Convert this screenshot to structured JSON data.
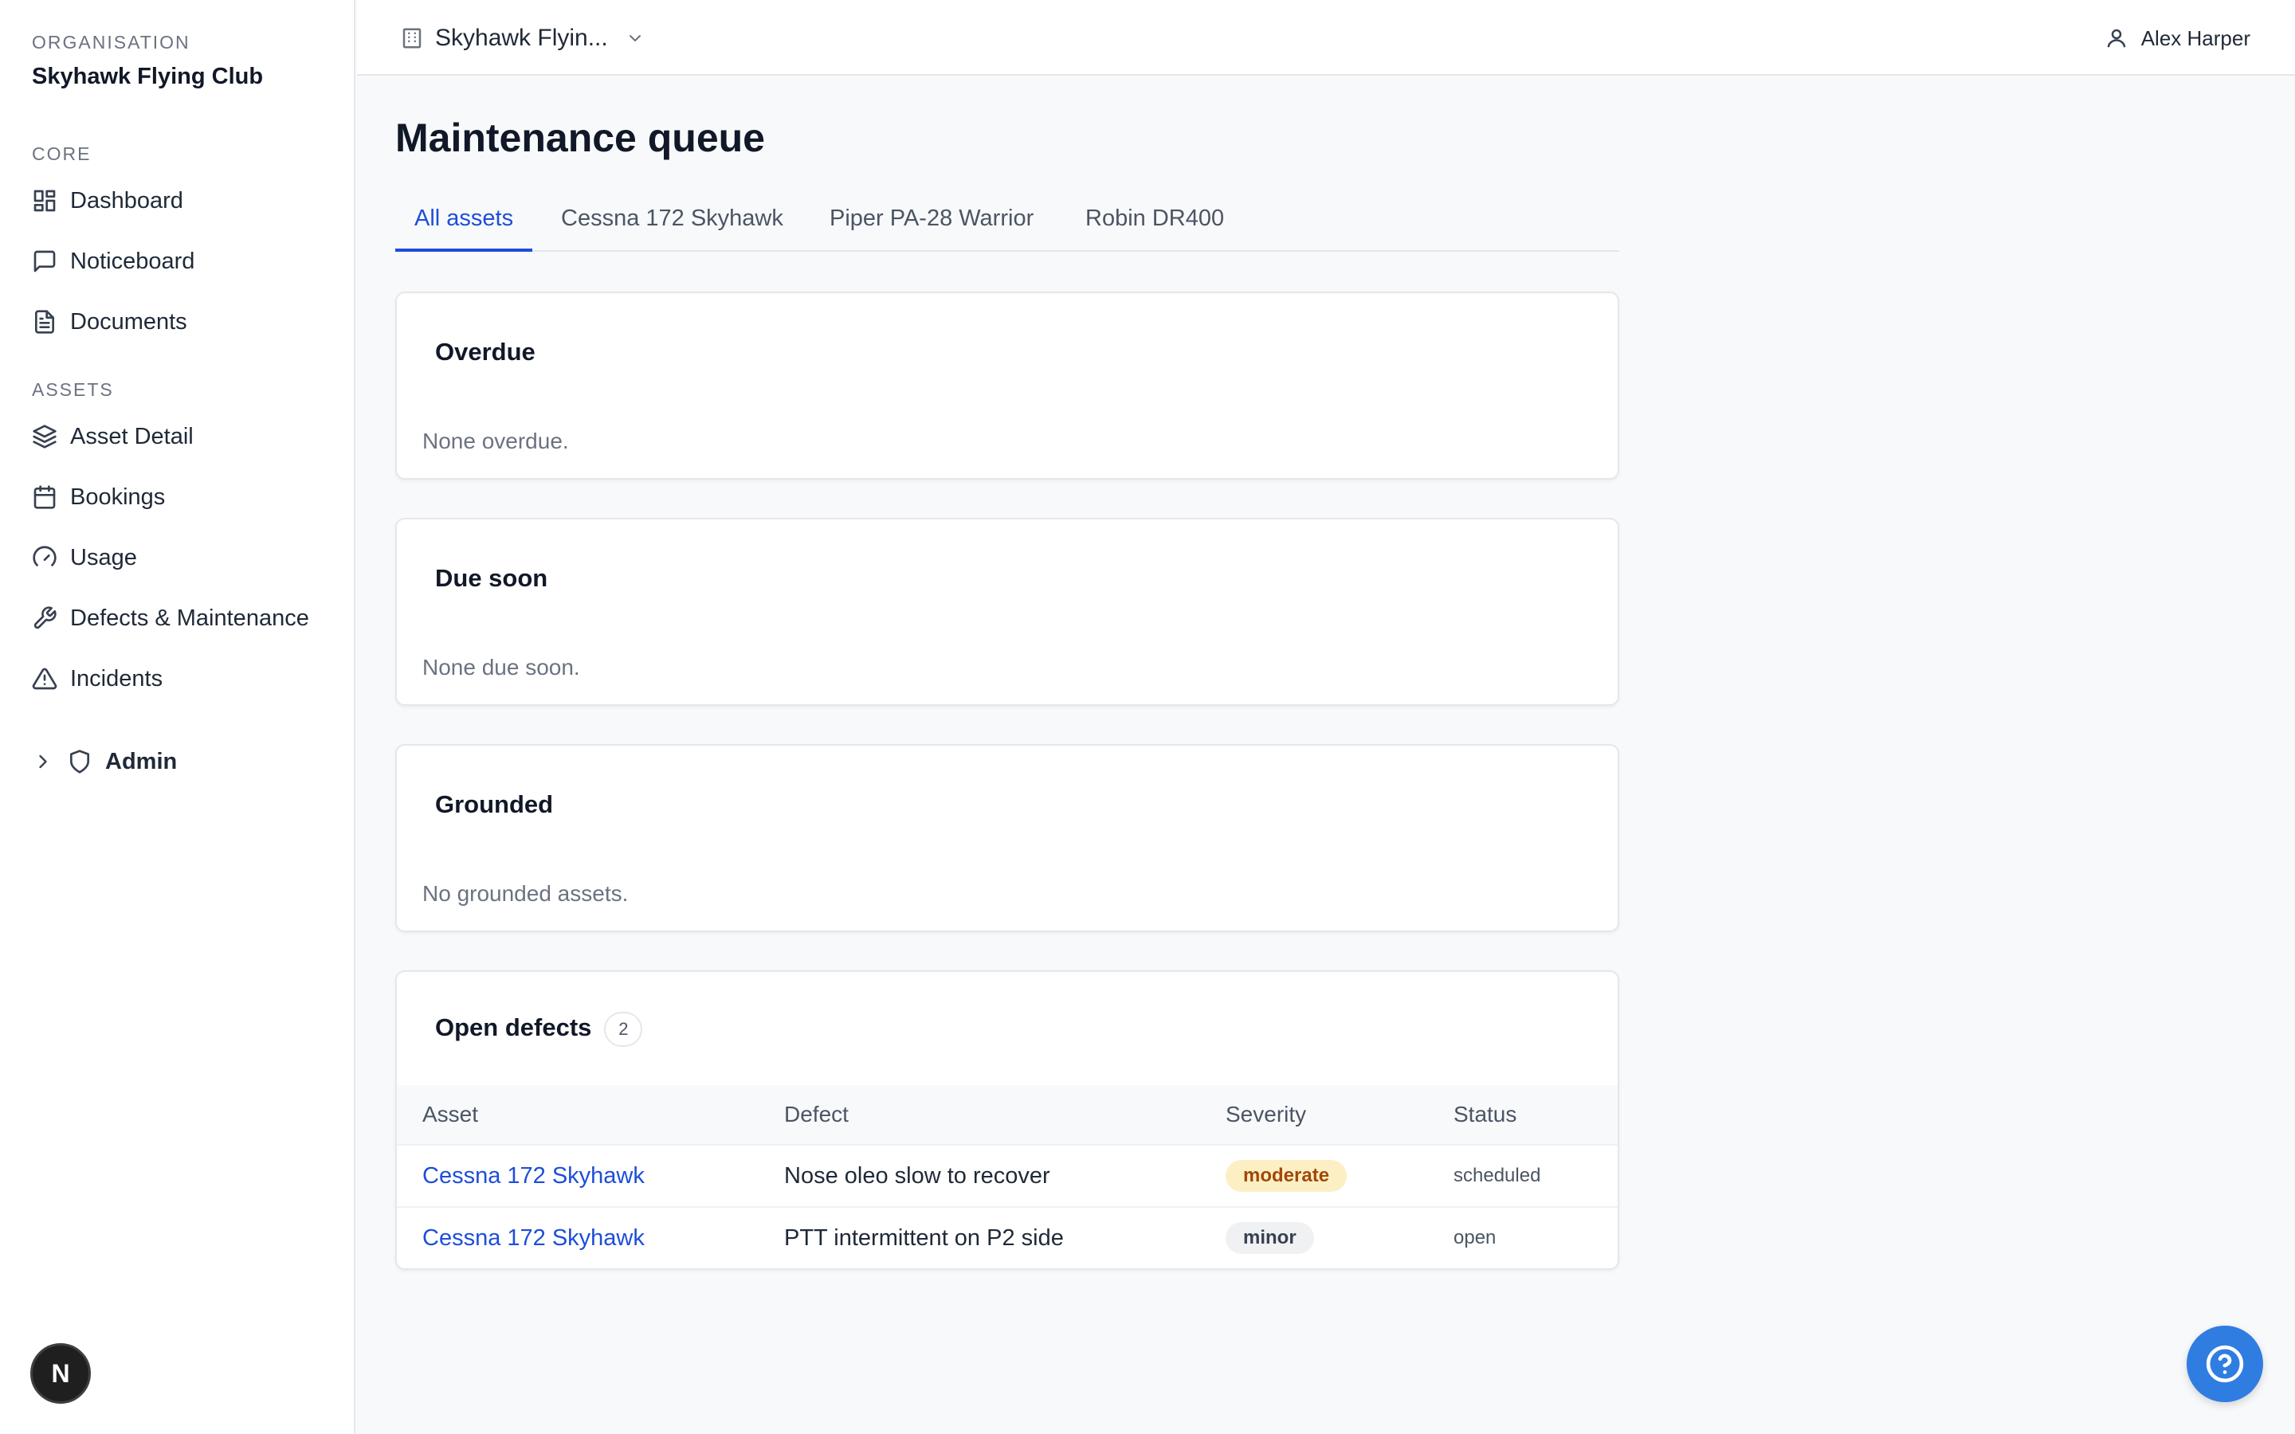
{
  "sidebar": {
    "org_label": "ORGANISATION",
    "org_name": "Skyhawk Flying Club",
    "sections": [
      {
        "label": "CORE",
        "items": [
          {
            "label": "Dashboard",
            "icon": "dashboard-icon"
          },
          {
            "label": "Noticeboard",
            "icon": "message-square-icon"
          },
          {
            "label": "Documents",
            "icon": "document-icon"
          }
        ]
      },
      {
        "label": "ASSETS",
        "items": [
          {
            "label": "Asset Detail",
            "icon": "layers-icon"
          },
          {
            "label": "Bookings",
            "icon": "calendar-icon"
          },
          {
            "label": "Usage",
            "icon": "gauge-icon"
          },
          {
            "label": "Defects & Maintenance",
            "icon": "wrench-icon"
          },
          {
            "label": "Incidents",
            "icon": "warning-triangle-icon"
          }
        ]
      }
    ],
    "admin": {
      "label": "Admin",
      "icon": "shield-icon"
    },
    "badge": {
      "letter": "N"
    }
  },
  "topbar": {
    "org_switch": "Skyhawk Flyin...",
    "user": "Alex Harper"
  },
  "main": {
    "title": "Maintenance queue",
    "tabs": [
      {
        "label": "All assets",
        "active": true
      },
      {
        "label": "Cessna 172 Skyhawk",
        "active": false
      },
      {
        "label": "Piper PA-28 Warrior",
        "active": false
      },
      {
        "label": "Robin DR400",
        "active": false
      }
    ],
    "cards": [
      {
        "title": "Overdue",
        "empty_text": "None overdue."
      },
      {
        "title": "Due soon",
        "empty_text": "None due soon."
      },
      {
        "title": "Grounded",
        "empty_text": "No grounded assets."
      }
    ],
    "open_defects": {
      "title": "Open defects",
      "count": "2",
      "columns": [
        "Asset",
        "Defect",
        "Severity",
        "Status"
      ],
      "rows": [
        {
          "asset": "Cessna 172 Skyhawk",
          "defect": "Nose oleo slow to recover",
          "severity": "moderate",
          "status": "scheduled"
        },
        {
          "asset": "Cessna 172 Skyhawk",
          "defect": "PTT intermittent on P2 side",
          "severity": "minor",
          "status": "open"
        }
      ]
    }
  },
  "colors": {
    "accent": "#1d4ed8",
    "help_button": "#2f7de1",
    "moderate_bg": "#fdefc4",
    "moderate_text": "#a1480a",
    "minor_bg": "#f0f1f3"
  }
}
